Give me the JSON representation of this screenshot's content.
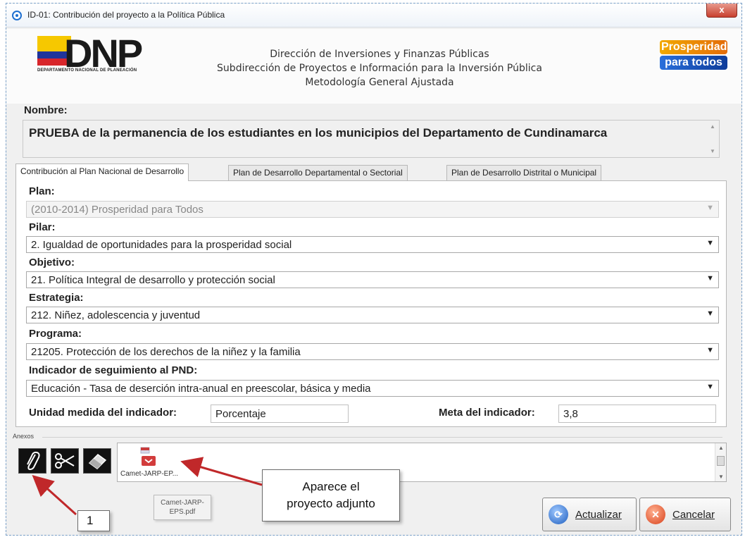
{
  "window": {
    "title": "ID-01: Contribución del proyecto a la Política Pública",
    "close_glyph": "x"
  },
  "header": {
    "logo_dnp": {
      "text": "DNP",
      "subtitle": "DEPARTAMENTO NACIONAL DE PLANEACIÓN"
    },
    "lines": [
      "Dirección de Inversiones y Finanzas Públicas",
      "Subdirección de Proyectos e Información para la Inversión Pública",
      "Metodología General Ajustada"
    ],
    "logo_right": {
      "line1": "Prosperidad",
      "line2": "para todos"
    }
  },
  "nombre": {
    "label": "Nombre:",
    "value": "PRUEBA de la permanencia de los estudiantes en los municipios del Departamento de Cundinamarca"
  },
  "tabs": [
    {
      "label": "Contribución al Plan Nacional de Desarrollo",
      "active": true
    },
    {
      "label": "Plan de Desarrollo Departamental o Sectorial",
      "active": false
    },
    {
      "label": "Plan de Desarrollo Distrital o Municipal",
      "active": false
    }
  ],
  "form": {
    "plan": {
      "label": "Plan:",
      "value": "(2010-2014) Prosperidad para Todos"
    },
    "pilar": {
      "label": "Pilar:",
      "value": "2. Igualdad de oportunidades para la prosperidad social"
    },
    "objetivo": {
      "label": "Objetivo:",
      "value": "21. Política Integral de desarrollo y protección social"
    },
    "estrategia": {
      "label": "Estrategia:",
      "value": "212. Niñez, adolescencia y juventud"
    },
    "programa": {
      "label": "Programa:",
      "value": "21205. Protección de los derechos de la niñez y la familia"
    },
    "indicador": {
      "label": "Indicador de seguimiento al PND:",
      "value": "Educación - Tasa de deserción intra-anual en preescolar, básica y media"
    },
    "unidad": {
      "label": "Unidad medida del indicador:",
      "value": "Porcentaje"
    },
    "meta": {
      "label": "Meta del indicador:",
      "value": "3,8"
    }
  },
  "anexos": {
    "label": "Anexos",
    "tools": [
      "paperclip-icon",
      "scissors-icon",
      "eraser-icon"
    ],
    "file_name": "Camet-JARP-EP...",
    "drag_ghost": [
      "Camet-JARP-",
      "EPS.pdf"
    ]
  },
  "annotations": {
    "callout_1": "1",
    "callout_2_line1": "Aparece el",
    "callout_2_line2": "proyecto adjunto",
    "arrow_color": "#c0282a"
  },
  "buttons": {
    "actualizar": "Actualizar",
    "cancelar": "Cancelar"
  }
}
